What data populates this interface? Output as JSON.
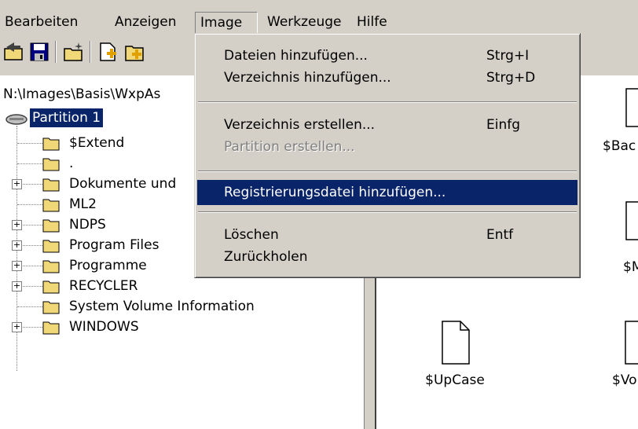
{
  "menubar": {
    "items": [
      {
        "label": "Bearbeiten"
      },
      {
        "label": "Anzeigen"
      },
      {
        "label": "Image"
      },
      {
        "label": "Werkzeuge"
      },
      {
        "label": "Hilfe"
      }
    ]
  },
  "toolbar": {
    "buttons": [
      {
        "icon": "open-icon"
      },
      {
        "icon": "save-icon"
      },
      {
        "icon": "new-folder-icon"
      },
      {
        "icon": "add-file-icon"
      },
      {
        "icon": "add-folder-icon"
      }
    ]
  },
  "tree": {
    "path": "N:\\Images\\Basis\\WxpAs",
    "root": "Partition 1",
    "items": [
      {
        "label": "$Extend"
      },
      {
        "label": "."
      },
      {
        "label": "Dokumente und"
      },
      {
        "label": "ML2"
      },
      {
        "label": "NDPS"
      },
      {
        "label": "Program Files"
      },
      {
        "label": "Programme"
      },
      {
        "label": "RECYCLER"
      },
      {
        "label": "System Volume Information"
      },
      {
        "label": "WINDOWS"
      }
    ]
  },
  "file_list": {
    "items": [
      {
        "label": "$Bac"
      },
      {
        "label": "$M"
      },
      {
        "label": "$UpCase"
      },
      {
        "label": "$Vo"
      }
    ]
  },
  "image_menu": {
    "items": [
      {
        "label": "Dateien hinzufügen...",
        "shortcut": "Strg+I"
      },
      {
        "label": "Verzeichnis hinzufügen...",
        "shortcut": "Strg+D"
      },
      {
        "label": "Verzeichnis erstellen...",
        "shortcut": "Einfg"
      },
      {
        "label": "Partition erstellen...",
        "shortcut": ""
      },
      {
        "label": "Registrierungsdatei hinzufügen...",
        "shortcut": ""
      },
      {
        "label": "Löschen",
        "shortcut": "Entf"
      },
      {
        "label": "Zurückholen",
        "shortcut": ""
      }
    ]
  },
  "colors": {
    "face": "#d4d0c8",
    "highlight": "#0a246a",
    "folder": "#f0d878"
  }
}
